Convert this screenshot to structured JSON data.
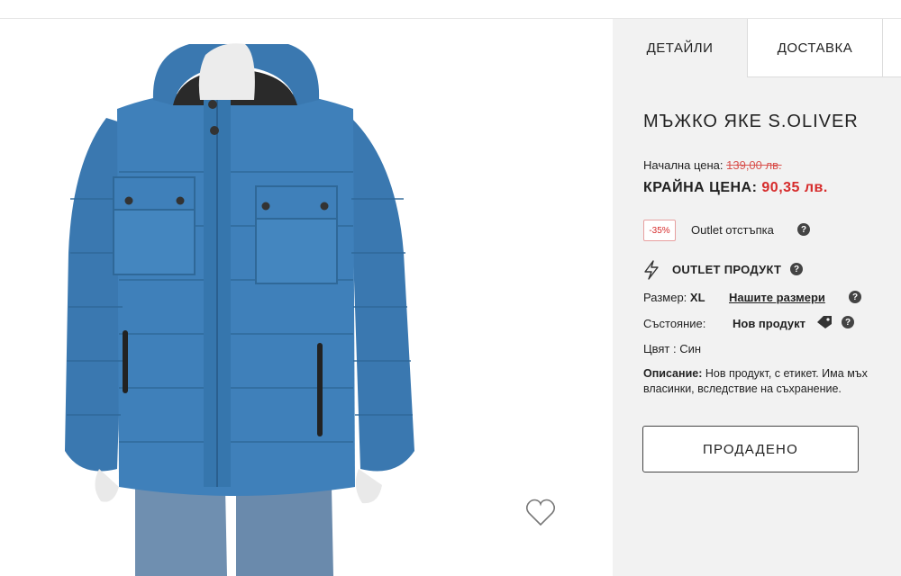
{
  "tabs": {
    "details": "ДЕТАЙЛИ",
    "delivery": "ДОСТАВКА"
  },
  "product": {
    "title": "МЪЖКО ЯКЕ S.OLIVER",
    "original_price_label": "Начална цена:",
    "original_price": "139,00 лв.",
    "final_price_label": "КРАЙНА ЦЕНА:",
    "final_price": "90,35 лв.",
    "discount_badge": "-35%",
    "discount_label": "Outlet отстъпка",
    "outlet_label": "OUTLET ПРОДУКТ",
    "size_label": "Размер:",
    "size_value": "XL",
    "size_guide_link": "Нашите размери",
    "condition_label": "Състояние:",
    "condition_value": "Нов продукт",
    "color_label": "Цвят :",
    "color_value": "Син",
    "description_label": "Описание:",
    "description_line1": "Нов продукт, с етикет. Има мъх",
    "description_line2": "власинки, вследствие на съхранение.",
    "sold_button": "ПРОДАДЕНО"
  },
  "help_glyph": "?",
  "icons": {
    "wishlist": "heart-icon",
    "outlet": "lightning-icon",
    "condition_tag": "tag-icon",
    "help": "question-icon"
  },
  "colors": {
    "panel_bg": "#f2f2f2",
    "price_red": "#d62b2b",
    "jacket_blue": "#3f7fb8"
  }
}
